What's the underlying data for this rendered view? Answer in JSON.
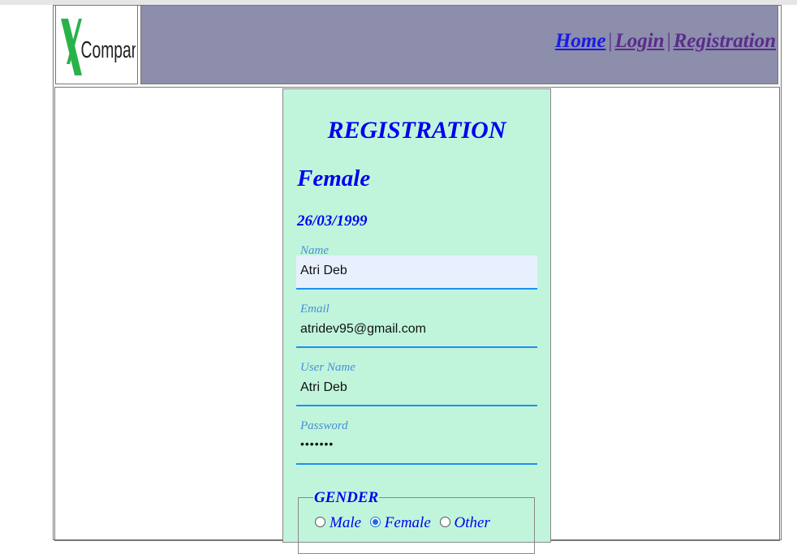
{
  "logo": {
    "text": "Company",
    "letter": "X",
    "accent_color": "#2ab24a"
  },
  "nav": {
    "items": [
      "Home",
      "Login",
      "Registration"
    ],
    "separator": "|"
  },
  "form": {
    "title": "REGISTRATION",
    "selected_gender_display": "Female",
    "dob_display": "26/03/1999",
    "fields": [
      {
        "label": "Name",
        "value": "Atri Deb"
      },
      {
        "label": "Email",
        "value": "atridev95@gmail.com"
      },
      {
        "label": "User Name",
        "value": "Atri Deb"
      },
      {
        "label": "Password",
        "value": "•••••••"
      }
    ],
    "gender": {
      "legend": "GENDER",
      "options": [
        "Male",
        "Female",
        "Other"
      ],
      "selected": "Female"
    }
  },
  "colors": {
    "header_bg": "#8c8eab",
    "panel_bg": "#c0f5dc",
    "text_blue": "#0000ee",
    "field_underline": "#1e8ff0",
    "visited_link": "#5a2c8c"
  }
}
